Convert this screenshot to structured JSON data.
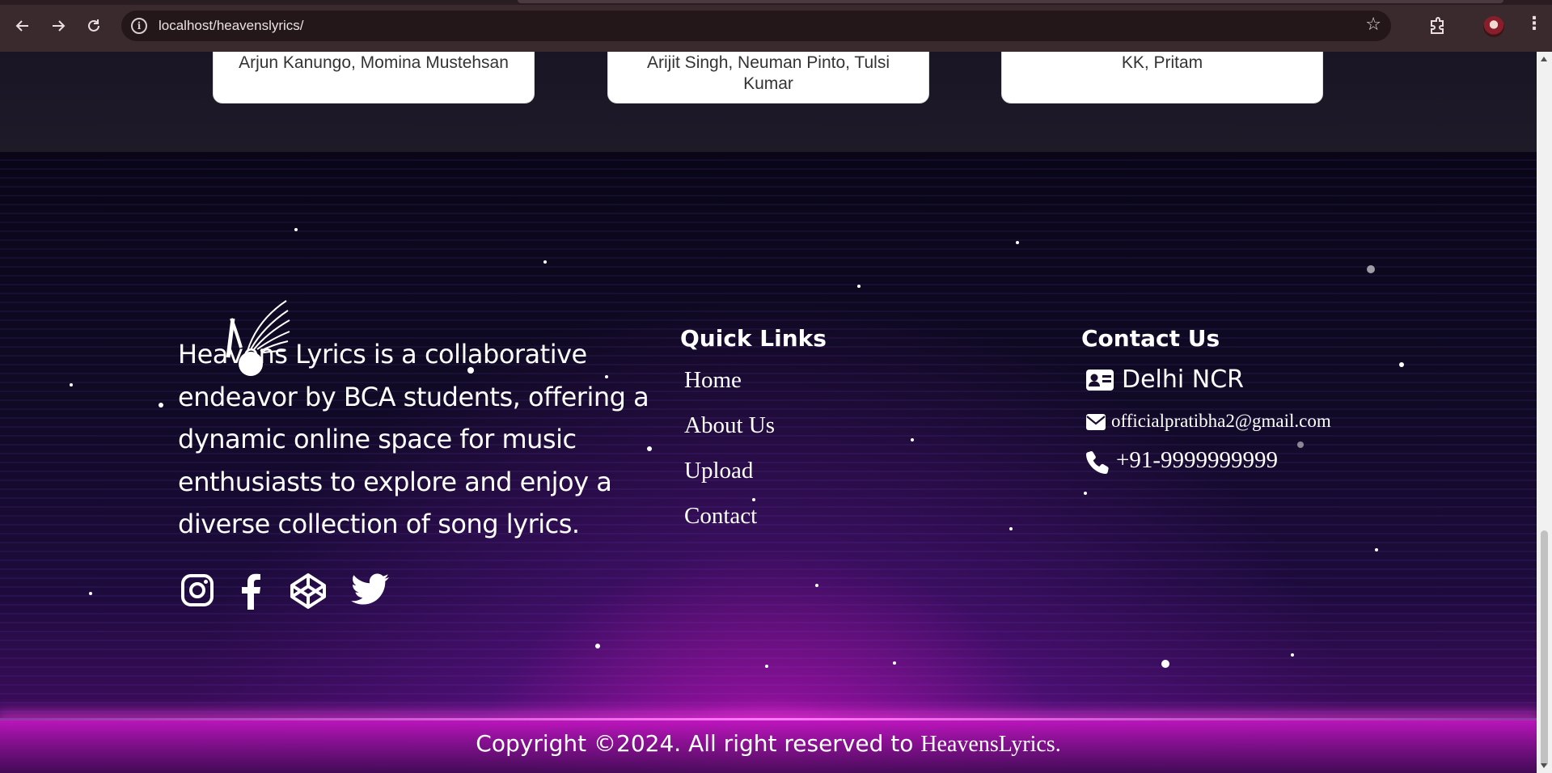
{
  "browser": {
    "url": "localhost/heavenslyrics/"
  },
  "songs": {
    "cards": [
      {
        "artists": "Arjun Kanungo, Momina Mustehsan"
      },
      {
        "artists": "Arijit Singh, Neuman Pinto, Tulsi Kumar"
      },
      {
        "artists": "KK, Pritam"
      }
    ]
  },
  "footer": {
    "about": "Heavens Lyrics is a collaborative endeavor by BCA students, offering a dynamic online space for music enthusiasts to explore and enjoy a diverse collection of song lyrics.",
    "social": [
      "instagram-icon",
      "facebook-icon",
      "codepen-icon",
      "twitter-icon"
    ],
    "quick_links": {
      "title": "Quick Links",
      "items": [
        "Home",
        "About Us",
        "Upload",
        "Contact"
      ]
    },
    "contact": {
      "title": "Contact Us",
      "location": "Delhi NCR",
      "email": "officialpratibha2@gmail.com",
      "phone": "+91-9999999999"
    },
    "copyright": {
      "text": "Copyright ©2024. All right reserved to ",
      "brand": "HeavensLyrics."
    }
  },
  "colors": {
    "accent_glow": "#ff3ce6",
    "footer_bg": "#0a0618"
  }
}
